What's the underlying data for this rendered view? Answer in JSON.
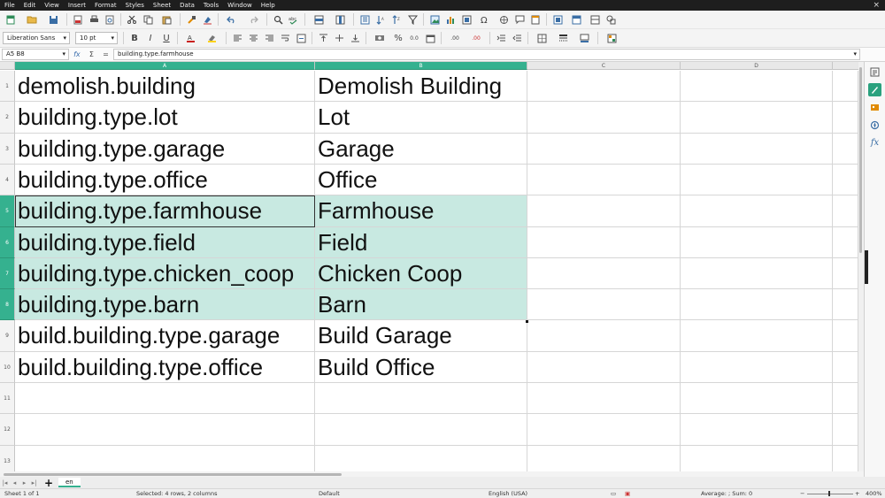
{
  "menu": [
    "File",
    "Edit",
    "View",
    "Insert",
    "Format",
    "Styles",
    "Sheet",
    "Data",
    "Tools",
    "Window",
    "Help"
  ],
  "close_glyph": "×",
  "format_bar": {
    "font_name": "Liberation Sans",
    "font_size": "10 pt",
    "bold": "B",
    "italic": "I",
    "underline": "U",
    "percent": "%",
    "decimals_1": ".00",
    "decimals_2": ".00"
  },
  "name_box": "A5 B8",
  "formula_icons": {
    "function_wizard": "fx",
    "sum": "Σ",
    "equals": "="
  },
  "formula_content": "building.type.farmhouse",
  "columns": [
    "A",
    "B",
    "C",
    "D"
  ],
  "rows": [
    {
      "num": "1",
      "a": "demolish.building",
      "b": "Demolish Building"
    },
    {
      "num": "2",
      "a": "building.type.lot",
      "b": "Lot"
    },
    {
      "num": "3",
      "a": "building.type.garage",
      "b": "Garage"
    },
    {
      "num": "4",
      "a": "building.type.office",
      "b": "Office"
    },
    {
      "num": "5",
      "a": "building.type.farmhouse",
      "b": "Farmhouse"
    },
    {
      "num": "6",
      "a": "building.type.field",
      "b": "Field"
    },
    {
      "num": "7",
      "a": "building.type.chicken_coop",
      "b": "Chicken Coop"
    },
    {
      "num": "8",
      "a": "building.type.barn",
      "b": "Barn"
    },
    {
      "num": "9",
      "a": "build.building.type.garage",
      "b": "Build Garage"
    },
    {
      "num": "10",
      "a": "build.building.type.office",
      "b": "Build Office"
    },
    {
      "num": "11",
      "a": "",
      "b": ""
    },
    {
      "num": "12",
      "a": "",
      "b": ""
    },
    {
      "num": "13",
      "a": "",
      "b": ""
    }
  ],
  "sheet_tabs": {
    "add": "+",
    "active_tab": "en"
  },
  "status": {
    "sheet": "Sheet 1 of 1",
    "selection": "Selected: 4 rows, 2 columns",
    "page_style": "Default",
    "language": "English (USA)",
    "summary": "Average: ; Sum: 0",
    "zoom_minus": "−",
    "zoom_plus": "+",
    "zoom": "400%"
  },
  "colors": {
    "selection_header": "#35b18f",
    "selection_fill": "#c8e9e1"
  }
}
